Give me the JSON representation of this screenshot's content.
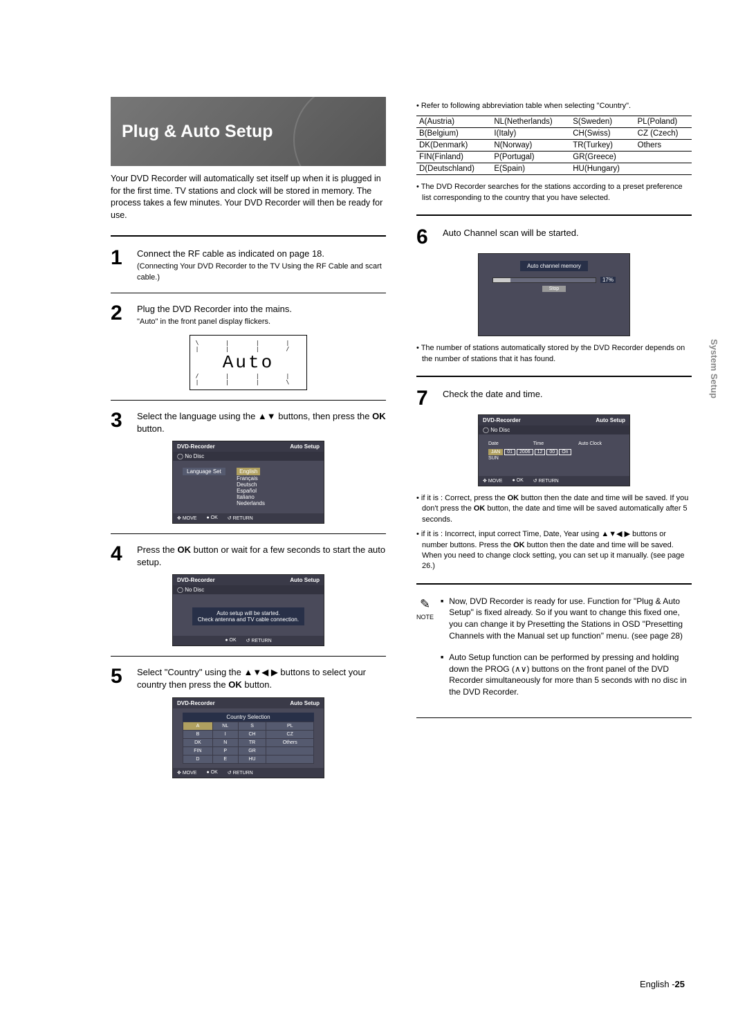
{
  "hero_title": "Plug & Auto Setup",
  "intro": "Your DVD Recorder will automatically set itself up when it is plugged in for the first time. TV stations and clock will be stored in memory. The process takes a few minutes. Your DVD Recorder will then be ready for use.",
  "steps": {
    "s1": {
      "n": "1",
      "text": "Connect the RF cable as indicated on page 18.",
      "sub": "(Connecting Your DVD Recorder to the TV Using the RF Cable and scart cable.)"
    },
    "s2": {
      "n": "2",
      "text": "Plug the DVD Recorder into the mains.",
      "sub": "\"Auto\" in the front panel display flickers."
    },
    "s3": {
      "n": "3",
      "text_pre": "Select the language using the ▲▼ buttons, then press the ",
      "bold": "OK",
      "text_post": " button."
    },
    "s4": {
      "n": "4",
      "text_pre": "Press the ",
      "bold": "OK",
      "text_post": " button or wait for a few seconds to start the auto setup."
    },
    "s5": {
      "n": "5",
      "text_pre": "Select \"Country\" using the ▲▼◀ ▶ buttons to select your country then press the ",
      "bold": "OK",
      "text_post": " button."
    },
    "s6": {
      "n": "6",
      "text": "Auto Channel scan will be started."
    },
    "s7": {
      "n": "7",
      "text": "Check the date and time."
    }
  },
  "lcd_text": "Auto",
  "osd": {
    "title": "DVD-Recorder",
    "corner": "Auto Setup",
    "nodisc": "No Disc",
    "footer_move": "MOVE",
    "footer_ok": "OK",
    "footer_return": "RETURN",
    "language_label": "Language Set",
    "languages": [
      "English",
      "Français",
      "Deutsch",
      "Español",
      "Italiano",
      "Nederlands"
    ],
    "autosetup_msg1": "Auto setup will be started.",
    "autosetup_msg2": "Check antenna and TV cable connection.",
    "country_head": "Country Selection",
    "country_grid": [
      [
        "A",
        "NL",
        "S",
        "PL"
      ],
      [
        "B",
        "I",
        "CH",
        "CZ"
      ],
      [
        "DK",
        "N",
        "TR",
        "Others"
      ],
      [
        "FIN",
        "P",
        "GR",
        ""
      ],
      [
        "D",
        "E",
        "HU",
        ""
      ]
    ],
    "channel_title": "Auto channel memory",
    "progress_pct": "17%",
    "stop": "Stop",
    "date_label": "Date",
    "time_label": "Time",
    "autoclock_label": "Auto Clock",
    "date_fields": [
      "JAN",
      "01",
      "2006",
      "12",
      "00",
      "On"
    ],
    "day": "SUN"
  },
  "right": {
    "abbr_intro": "• Refer to following abbreviation table when selecting \"Country\".",
    "table": [
      [
        "A(Austria)",
        "NL(Netherlands)",
        "S(Sweden)",
        "PL(Poland)"
      ],
      [
        "B(Belgium)",
        "I(Italy)",
        "CH(Swiss)",
        "CZ (Czech)"
      ],
      [
        "DK(Denmark)",
        "N(Norway)",
        "TR(Turkey)",
        "Others"
      ],
      [
        "FIN(Finland)",
        "P(Portugal)",
        "GR(Greece)",
        ""
      ],
      [
        "D(Deutschland)",
        "E(Spain)",
        "HU(Hungary)",
        ""
      ]
    ],
    "bullet_pref": "• The DVD Recorder searches for the stations according to a preset preference list corresponding to the country that you have selected.",
    "bullet_stored": "• The number of stations automatically stored by the DVD Recorder depends on the number of stations that it has found.",
    "bullet7a_prefix": "• if it is : Correct, press the ",
    "bullet7a_mid": " button then the date and time will be saved. If you don't press the ",
    "bullet7a_end": " button, the date and time will be saved automatically after 5 seconds.",
    "bullet7b_prefix": "• if it is : Incorrect, input correct Time, Date, Year using ▲▼◀ ▶ buttons or number buttons. Press the ",
    "bullet7b_end": " button then the date and time will be saved. When you need to change clock setting, you can set up it manually. (see page 26.)",
    "ok": "OK",
    "note_label": "NOTE",
    "note1": "Now, DVD Recorder is ready for use. Function for \"Plug & Auto Setup\" is fixed already. So if you want to change this fixed one, you can change it by Presetting the Stations in OSD \"Presetting Channels with the Manual set up function\" menu. (see page 28)",
    "note2": "Auto Setup function can be performed by pressing and holding down the PROG (∧∨) buttons on the front panel of the DVD Recorder simultaneously for more than 5 seconds with no disc in the DVD Recorder."
  },
  "sidebar": "System Setup",
  "footer_lang": "English -",
  "footer_page": "25"
}
